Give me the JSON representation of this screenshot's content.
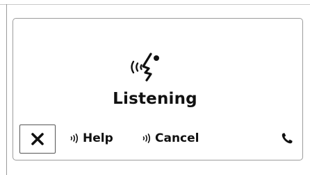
{
  "voice": {
    "status": "Listening",
    "icon": "voice-recognition-icon"
  },
  "controls": {
    "close_icon": "close-icon",
    "commands": [
      {
        "label": "Help",
        "icon": "speak-icon"
      },
      {
        "label": "Cancel",
        "icon": "speak-icon"
      }
    ],
    "phone_icon": "phone-icon"
  }
}
